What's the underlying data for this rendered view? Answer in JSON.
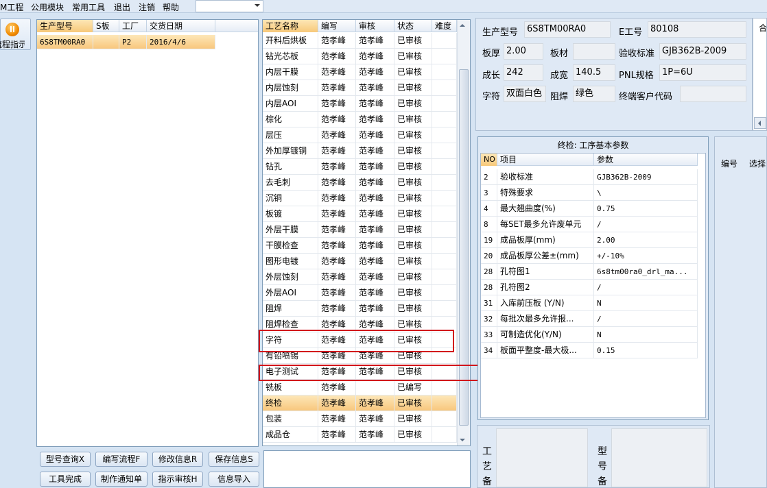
{
  "menu": [
    "M工程",
    "公用模块",
    "常用工具",
    "退出",
    "注销",
    "帮助"
  ],
  "nav_button": {
    "label": "流程指示"
  },
  "order_grid": {
    "headers": [
      "生产型号",
      "S板",
      "工厂",
      "交货日期"
    ],
    "rows": [
      {
        "model": "6S8TM00RA0",
        "s": "",
        "factory": "P2",
        "date": "2016/4/6"
      }
    ]
  },
  "buttons": {
    "query": "型号查询X",
    "write_flow": "编写流程F",
    "modify": "修改信息R",
    "save": "保存信息S",
    "tool_done": "工具完成",
    "notice": "制作通知单",
    "review": "指示审核H",
    "import": "信息导入"
  },
  "process_grid": {
    "headers": [
      "工艺名称",
      "编写",
      "审核",
      "状态",
      "难度"
    ],
    "rows": [
      [
        "开料后烘板",
        "范孝峰",
        "范孝峰",
        "已审核"
      ],
      [
        "钻光芯板",
        "范孝峰",
        "范孝峰",
        "已审核"
      ],
      [
        "内层干膜",
        "范孝峰",
        "范孝峰",
        "已审核"
      ],
      [
        "内层蚀刻",
        "范孝峰",
        "范孝峰",
        "已审核"
      ],
      [
        "内层AOI",
        "范孝峰",
        "范孝峰",
        "已审核"
      ],
      [
        "棕化",
        "范孝峰",
        "范孝峰",
        "已审核"
      ],
      [
        "层压",
        "范孝峰",
        "范孝峰",
        "已审核"
      ],
      [
        "外加厚镀铜",
        "范孝峰",
        "范孝峰",
        "已审核"
      ],
      [
        "钻孔",
        "范孝峰",
        "范孝峰",
        "已审核"
      ],
      [
        "去毛刺",
        "范孝峰",
        "范孝峰",
        "已审核"
      ],
      [
        "沉铜",
        "范孝峰",
        "范孝峰",
        "已审核"
      ],
      [
        "板镀",
        "范孝峰",
        "范孝峰",
        "已审核"
      ],
      [
        "外层干膜",
        "范孝峰",
        "范孝峰",
        "已审核"
      ],
      [
        "干膜检查",
        "范孝峰",
        "范孝峰",
        "已审核"
      ],
      [
        "图形电镀",
        "范孝峰",
        "范孝峰",
        "已审核"
      ],
      [
        "外层蚀刻",
        "范孝峰",
        "范孝峰",
        "已审核"
      ],
      [
        "外层AOI",
        "范孝峰",
        "范孝峰",
        "已审核"
      ],
      [
        "阻焊",
        "范孝峰",
        "范孝峰",
        "已审核"
      ],
      [
        "阻焊检查",
        "范孝峰",
        "范孝峰",
        "已审核"
      ],
      [
        "字符",
        "范孝峰",
        "范孝峰",
        "已审核"
      ],
      [
        "有铅喷锡",
        "范孝峰",
        "范孝峰",
        "已审核"
      ],
      [
        "电子测试",
        "范孝峰",
        "范孝峰",
        "已审核"
      ],
      [
        "铣板",
        "范孝峰",
        "",
        "已编写"
      ],
      [
        "终检",
        "范孝峰",
        "范孝峰",
        "已审核"
      ],
      [
        "包装",
        "范孝峰",
        "范孝峰",
        "已审核"
      ],
      [
        "成品仓",
        "范孝峰",
        "范孝峰",
        "已审核"
      ]
    ]
  },
  "info": {
    "model_label": "生产型号",
    "model": "6S8TM00RA0",
    "eng_label": "E工号",
    "eng": "80108",
    "thick_label": "板厚",
    "thick": "2.00",
    "material_label": "板材",
    "material": "",
    "accept_label": "验收标准",
    "accept": "GJB362B-2009",
    "length_label": "成长",
    "length": "242",
    "width_label": "成宽",
    "width": "140.5",
    "pnl_label": "PNL规格",
    "pnl": "1P=6U",
    "char_label": "字符",
    "char": "双面白色",
    "mask_label": "阻焊",
    "mask": "绿色",
    "customer_label": "终端客户代码",
    "customer": ""
  },
  "right_tab": "合",
  "params": {
    "title": "终检: 工序基本参数",
    "headers": [
      "NO",
      "项目",
      "参数"
    ],
    "rows": [
      [
        "2",
        "验收标准",
        "GJB362B-2009"
      ],
      [
        "3",
        "特殊要求",
        "\\"
      ],
      [
        "4",
        "最大翘曲度(%)",
        "0.75"
      ],
      [
        "8",
        "每SET最多允许废单元",
        "/"
      ],
      [
        "19",
        "成品板厚(mm)",
        "2.00"
      ],
      [
        "20",
        "成品板厚公差±(mm)",
        "+/-10%"
      ],
      [
        "28",
        "孔符图1",
        "6s8tm00ra0_drl_ma..."
      ],
      [
        "28",
        "孔符图2",
        "/"
      ],
      [
        "31",
        "入库前压板 (Y/N)",
        "N"
      ],
      [
        "32",
        "每批次最多允许报...",
        "/"
      ],
      [
        "33",
        "可制造优化(Y/N)",
        "N"
      ],
      [
        "34",
        "板面平整度-最大极...",
        "0.15"
      ]
    ]
  },
  "side_grid": {
    "headers": [
      "编号",
      "选择"
    ]
  },
  "notes": {
    "process_label": "工艺备注",
    "model_label": "型号备注"
  }
}
